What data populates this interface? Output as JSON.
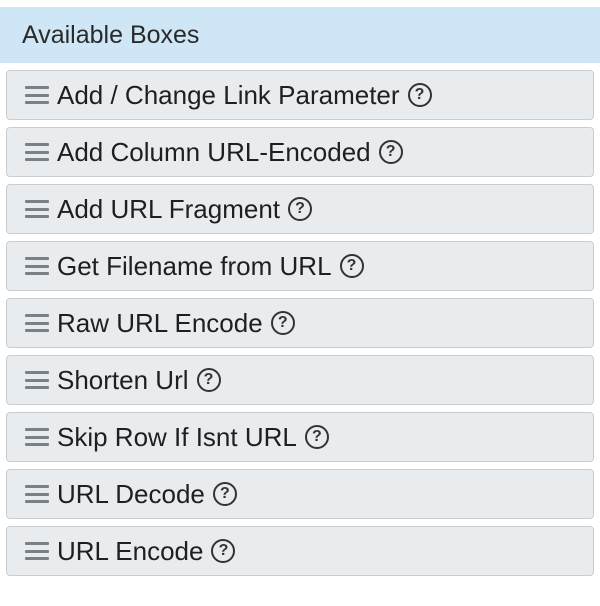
{
  "panel": {
    "title": "Available Boxes",
    "items": [
      {
        "label": "Add / Change Link Parameter",
        "help_glyph": "?"
      },
      {
        "label": "Add Column URL-Encoded",
        "help_glyph": "?"
      },
      {
        "label": "Add URL Fragment",
        "help_glyph": "?"
      },
      {
        "label": "Get Filename from URL",
        "help_glyph": "?"
      },
      {
        "label": "Raw URL Encode",
        "help_glyph": "?"
      },
      {
        "label": "Shorten Url",
        "help_glyph": "?"
      },
      {
        "label": "Skip Row If Isnt URL",
        "help_glyph": "?"
      },
      {
        "label": "URL Decode",
        "help_glyph": "?"
      },
      {
        "label": "URL Encode",
        "help_glyph": "?"
      }
    ]
  },
  "icons": {
    "drag": "drag-handle-icon",
    "help": "question-circle-icon"
  },
  "colors": {
    "header_bg": "#cfe6f7",
    "item_bg": "#e9ecef",
    "item_border": "#c8cdd2"
  }
}
